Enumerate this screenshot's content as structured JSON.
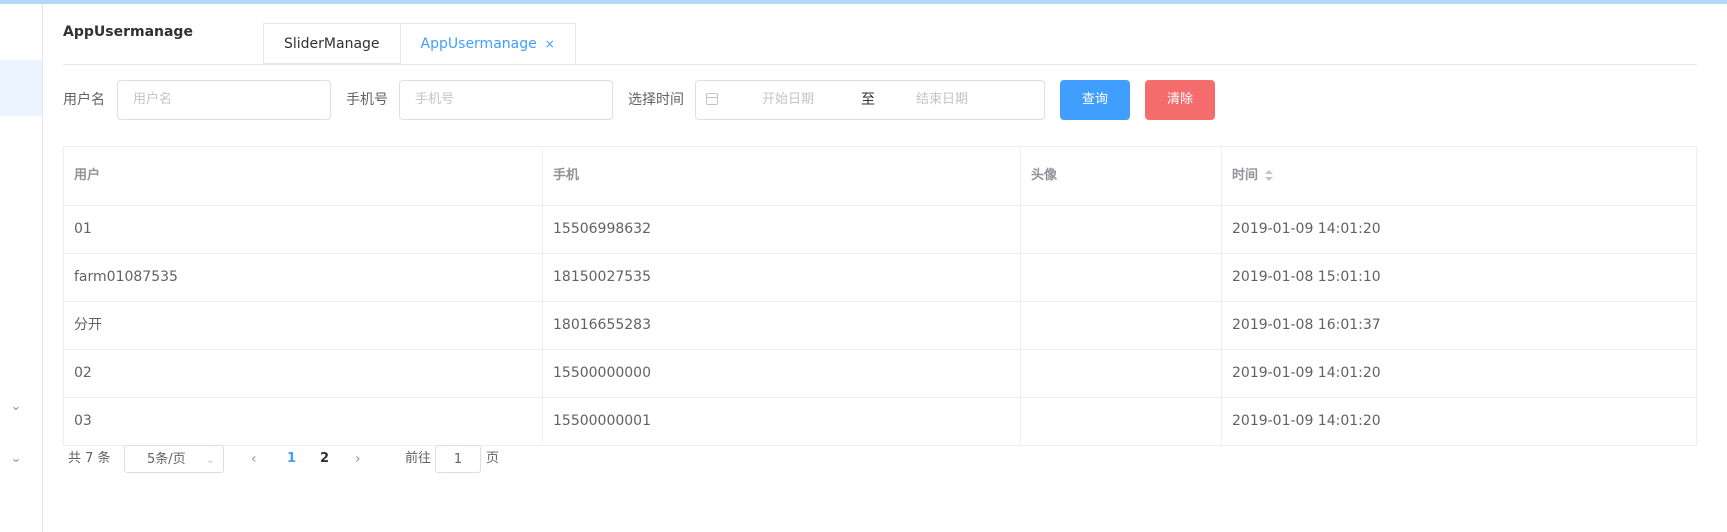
{
  "app_title": "AppUsermanage",
  "tabs": [
    {
      "label": "SliderManage"
    },
    {
      "label": "AppUsermanage",
      "close": "×"
    }
  ],
  "filters": {
    "username_label": "用户名",
    "username_placeholder": "用户名",
    "phone_label": "手机号",
    "phone_placeholder": "手机号",
    "time_label": "选择时间",
    "start_placeholder": "开始日期",
    "range_separator": "至",
    "end_placeholder": "结束日期",
    "query_label": "查询",
    "clear_label": "清除"
  },
  "table": {
    "headers": [
      "用户",
      "手机",
      "头像",
      "时间"
    ],
    "rows": [
      [
        "01",
        "15506998632",
        "",
        "2019-01-09 14:01:20"
      ],
      [
        "farm01087535",
        "18150027535",
        "",
        "2019-01-08 15:01:10"
      ],
      [
        "分开",
        "18016655283",
        "",
        "2019-01-08 16:01:37"
      ],
      [
        "02",
        "15500000000",
        "",
        "2019-01-09 14:01:20"
      ],
      [
        "03",
        "15500000001",
        "",
        "2019-01-09 14:01:20"
      ]
    ]
  },
  "pagination": {
    "total_text": "共 7 条",
    "page_size": "5条/页",
    "pages": [
      "1",
      "2"
    ],
    "current_page": "1",
    "goto_label": "前往",
    "goto_value": "1",
    "page_suffix": "页"
  },
  "colors": {
    "primary": "#409eff",
    "danger": "#f56c6c"
  }
}
